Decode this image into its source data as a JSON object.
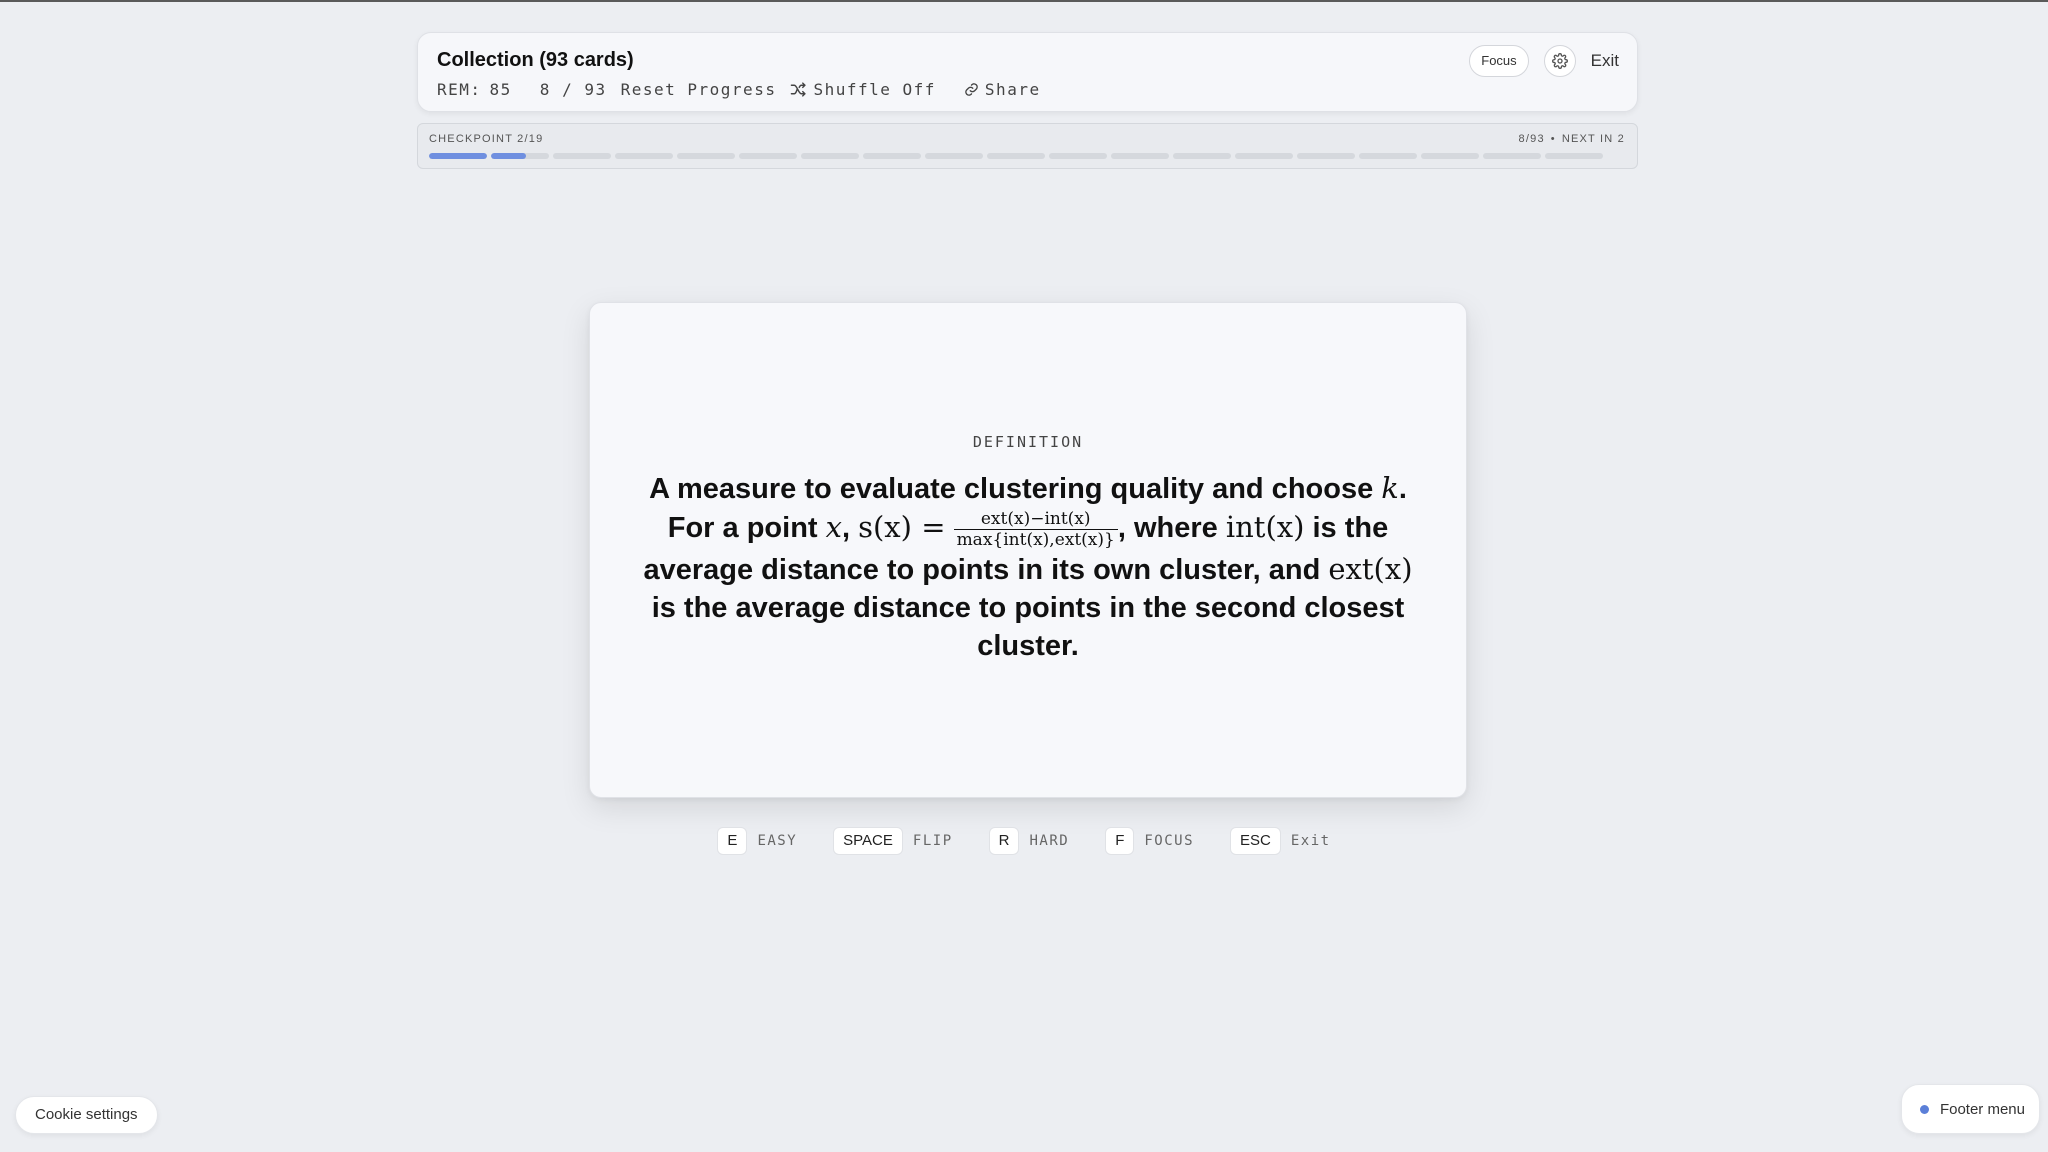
{
  "header": {
    "title": "Collection (93 cards)",
    "rem_label": "REM:",
    "rem_value": "85",
    "progress": "8 / 93",
    "reset_label": "Reset Progress",
    "shuffle_label": "Shuffle Off",
    "share_label": "Share",
    "focus_label": "Focus",
    "exit_label": "Exit",
    "icons": {
      "shuffle": "shuffle-icon",
      "share": "link-icon",
      "settings": "gear-icon"
    }
  },
  "checkpoint": {
    "label": "CHECKPOINT 2/19",
    "count": "8/93",
    "separator": "•",
    "next": "NEXT IN 2",
    "segments_total": 19,
    "segment_fills": [
      1,
      0.6,
      0,
      0,
      0,
      0,
      0,
      0,
      0,
      0,
      0,
      0,
      0,
      0,
      0,
      0,
      0,
      0,
      0
    ],
    "fill_color": "#6f8fe0",
    "track_color": "#d5d8dd"
  },
  "card": {
    "kind": "DEFINITION",
    "text": {
      "p1": "A measure to evaluate clustering quality and choose ",
      "k": "k",
      "p2": ".",
      "p3": "For a point ",
      "x": "x",
      "comma": ", ",
      "s_lhs": "s(x) =",
      "frac_num": "ext(x)−int(x)",
      "frac_den": "max{int(x),ext(x)}",
      "p4": ", where ",
      "int_x": "int(x)",
      "p5": " is the average distance to points in its own cluster, and ",
      "ext_x": "ext(x)",
      "p6": " is the average distance to points in the second closest cluster."
    }
  },
  "shortcuts": [
    {
      "key": "E",
      "label": "EASY"
    },
    {
      "key": "SPACE",
      "label": "FLIP"
    },
    {
      "key": "R",
      "label": "HARD"
    },
    {
      "key": "F",
      "label": "FOCUS"
    },
    {
      "key": "ESC",
      "label": "Exit"
    }
  ],
  "cookie_label": "Cookie settings",
  "footer_menu_label": "Footer menu",
  "colors": {
    "accent": "#6f8fe0",
    "footer_dot": "#5b7fd8",
    "background": "#eceef2"
  }
}
